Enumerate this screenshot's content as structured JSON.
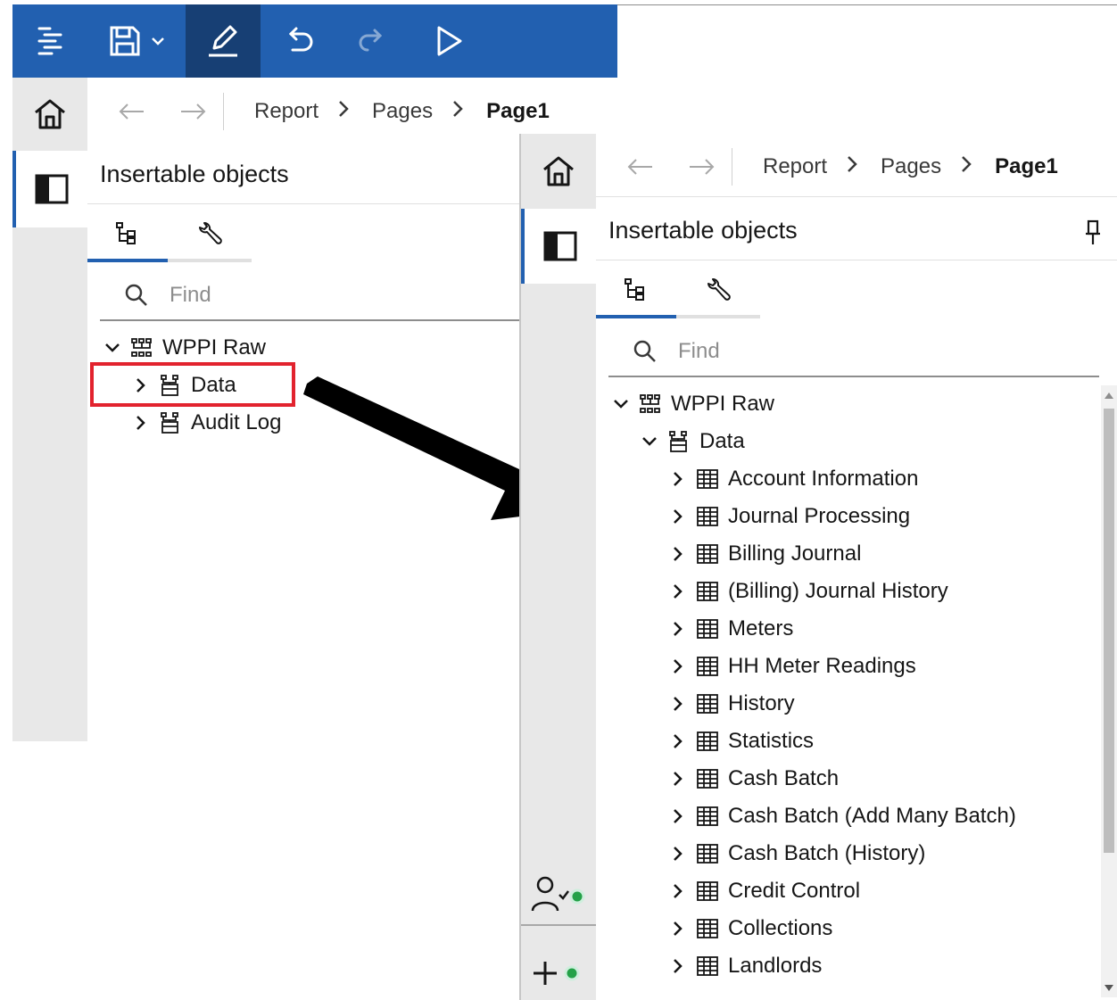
{
  "toolbar": {
    "icons": [
      "menu-icon",
      "save-icon",
      "chevron-down-icon",
      "edit-icon",
      "undo-icon",
      "redo-icon",
      "run-icon"
    ]
  },
  "left_view": {
    "breadcrumb": {
      "items": [
        "Report",
        "Pages"
      ],
      "current": "Page1"
    },
    "panel_title": "Insertable objects",
    "search": {
      "placeholder": "Find"
    },
    "tree": {
      "root": "WPPI Raw",
      "children": [
        "Data",
        "Audit Log"
      ]
    }
  },
  "right_view": {
    "breadcrumb": {
      "items": [
        "Report",
        "Pages"
      ],
      "current": "Page1"
    },
    "panel_title": "Insertable objects",
    "search": {
      "placeholder": "Find"
    },
    "tree": {
      "root": "WPPI Raw",
      "folder": "Data",
      "tables": [
        "Account Information",
        "Journal Processing",
        "Billing Journal",
        "(Billing) Journal History",
        "Meters",
        "HH Meter Readings",
        "History",
        "Statistics",
        "Cash Batch",
        "Cash Batch (Add Many Batch)",
        "Cash Batch (History)",
        "Credit Control",
        "Collections",
        "Landlords"
      ]
    }
  },
  "colors": {
    "toolbar": "#2260b0",
    "toolbar_active": "#173f74",
    "accent": "#2260b0",
    "highlight": "#e2232e",
    "status_dot": "#24a148",
    "rail": "#e8e8e8"
  }
}
